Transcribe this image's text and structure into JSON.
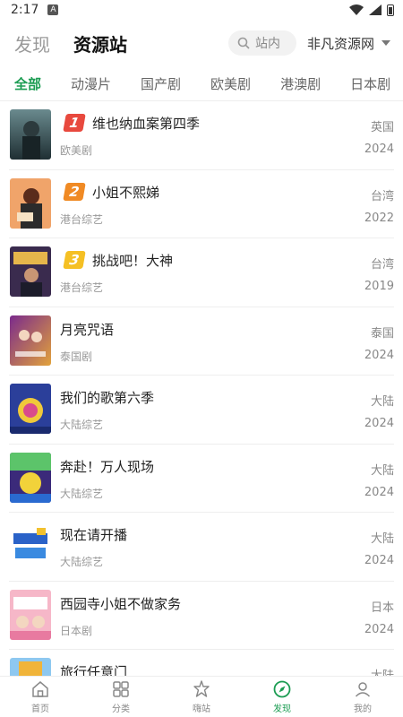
{
  "status_bar": {
    "time": "2:17",
    "notif_letter": "A"
  },
  "header": {
    "title_discover": "发现",
    "title_resource": "资源站",
    "search_label": "站内",
    "site_name": "非凡资源网"
  },
  "tabs": [
    "全部",
    "动漫片",
    "国产剧",
    "欧美剧",
    "港澳剧",
    "日本剧"
  ],
  "items": [
    {
      "rank": "1",
      "rank_color": "#e8493e",
      "title": "维也纳血案第四季",
      "genre": "欧美剧",
      "region": "英国",
      "year": "2024"
    },
    {
      "rank": "2",
      "rank_color": "#f08a24",
      "title": "小姐不熙娣",
      "genre": "港台综艺",
      "region": "台湾",
      "year": "2022"
    },
    {
      "rank": "3",
      "rank_color": "#f5c024",
      "title": "挑战吧！大神",
      "genre": "港台综艺",
      "region": "台湾",
      "year": "2019"
    },
    {
      "rank": "",
      "title": "月亮咒语",
      "genre": "泰国剧",
      "region": "泰国",
      "year": "2024"
    },
    {
      "rank": "",
      "title": "我们的歌第六季",
      "genre": "大陆综艺",
      "region": "大陆",
      "year": "2024"
    },
    {
      "rank": "",
      "title": "奔赴！万人现场",
      "genre": "大陆综艺",
      "region": "大陆",
      "year": "2024"
    },
    {
      "rank": "",
      "title": "现在请开播",
      "genre": "大陆综艺",
      "region": "大陆",
      "year": "2024"
    },
    {
      "rank": "",
      "title": "西园寺小姐不做家务",
      "genre": "日本剧",
      "region": "日本",
      "year": "2024"
    },
    {
      "rank": "",
      "title": "旅行任意门",
      "genre": "",
      "region": "大陆",
      "year": ""
    }
  ],
  "bottom_nav": [
    {
      "label": "首页",
      "icon": "home-icon"
    },
    {
      "label": "分类",
      "icon": "grid-icon"
    },
    {
      "label": "嗨站",
      "icon": "spark-icon"
    },
    {
      "label": "发现",
      "icon": "compass-icon"
    },
    {
      "label": "我的",
      "icon": "user-icon"
    }
  ],
  "colors": {
    "accent": "#1b9c52"
  }
}
